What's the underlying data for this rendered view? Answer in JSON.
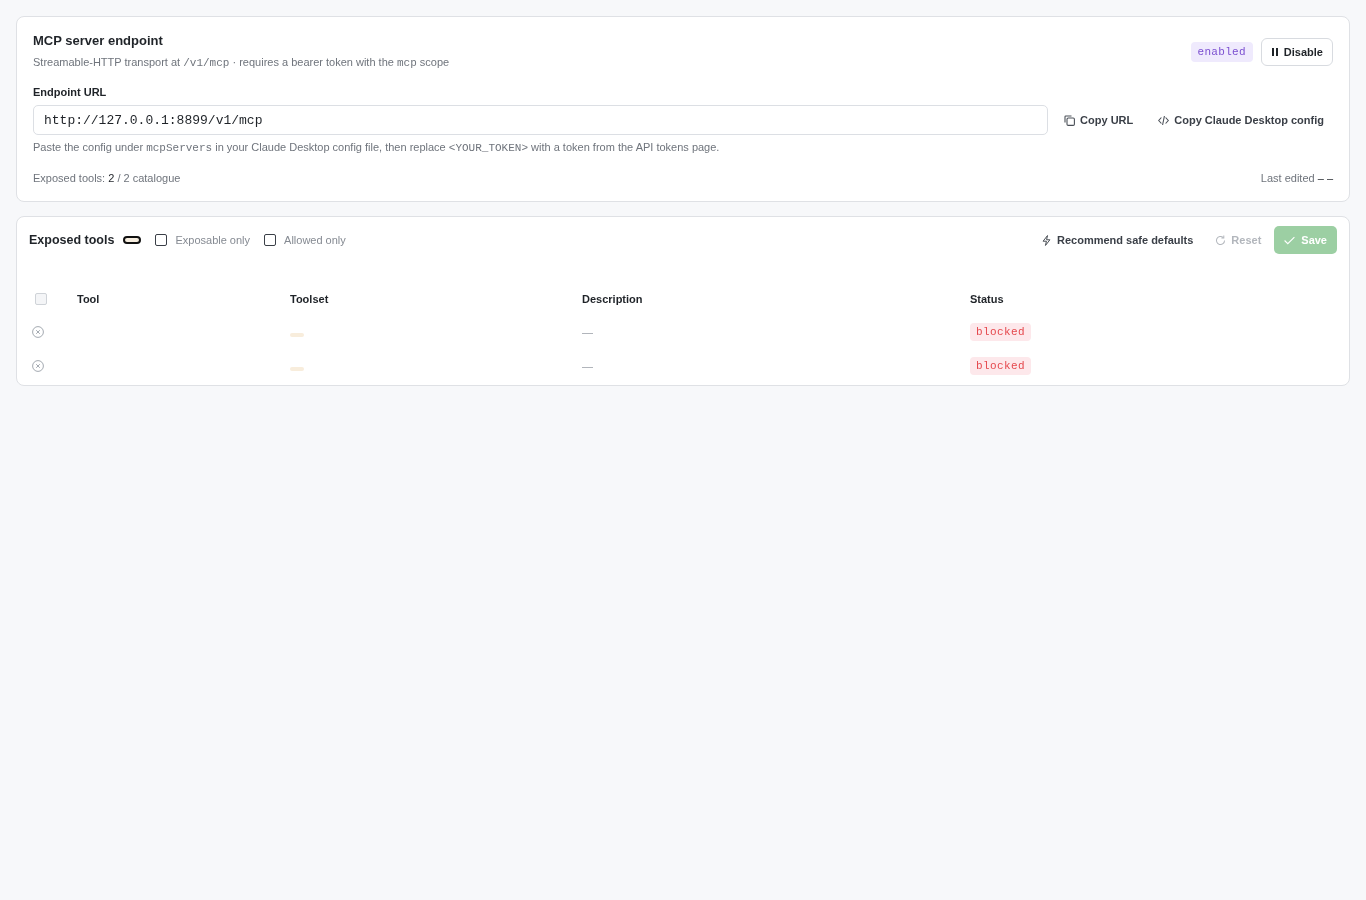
{
  "endpoint_card": {
    "title": "MCP server endpoint",
    "subtitle": [
      {
        "kind": "text",
        "text": "Streamable-HTTP transport at "
      },
      {
        "kind": "code",
        "text": "/v1/mcp"
      },
      {
        "kind": "text",
        "text": " · requires a bearer token with the "
      },
      {
        "kind": "code",
        "text": "mcp"
      },
      {
        "kind": "text",
        "text": " scope"
      }
    ],
    "status_badge": {
      "label": "enabled",
      "enabled": true
    },
    "disable_button": {
      "label": "Disable"
    },
    "url_label": "Endpoint URL",
    "url_field": {
      "value": "http://127.0.0.1:8899/v1/mcp"
    },
    "copy_url_button": {
      "label": "Copy URL"
    },
    "copy_config_button": {
      "label": "Copy Claude Desktop config"
    },
    "help_text": [
      {
        "kind": "text",
        "text": "Paste the config under "
      },
      {
        "kind": "code",
        "text": "mcpServers"
      },
      {
        "kind": "text",
        "text": " in your Claude Desktop config file, then replace "
      },
      {
        "kind": "code",
        "text": "<YOUR_TOKEN>"
      },
      {
        "kind": "text",
        "text": " with a token from the API tokens page."
      }
    ],
    "exposed_summary": "Exposed tools: **2** / 2 catalogue",
    "last_edited": "Last edited **– –**"
  },
  "tools_card": {
    "title": "Exposed tools",
    "filters": [
      {
        "label": "Exposable only",
        "checked": false
      },
      {
        "label": "Allowed only",
        "checked": false
      }
    ],
    "recommend_button": {
      "label": "Recommend safe defaults",
      "disabled": false
    },
    "reset_button": {
      "label": "Reset",
      "disabled": true
    },
    "save_button": {
      "label": "Save",
      "disabled": true
    },
    "table": {
      "select_all": {
        "checked": false,
        "disabled": true
      },
      "columns": [
        "Tool",
        "Toolset",
        "Description",
        "Status"
      ],
      "rows": [
        {
          "selectable": false,
          "description": "—",
          "status": "blocked"
        },
        {
          "selectable": false,
          "description": "—",
          "status": "blocked"
        }
      ]
    }
  }
}
